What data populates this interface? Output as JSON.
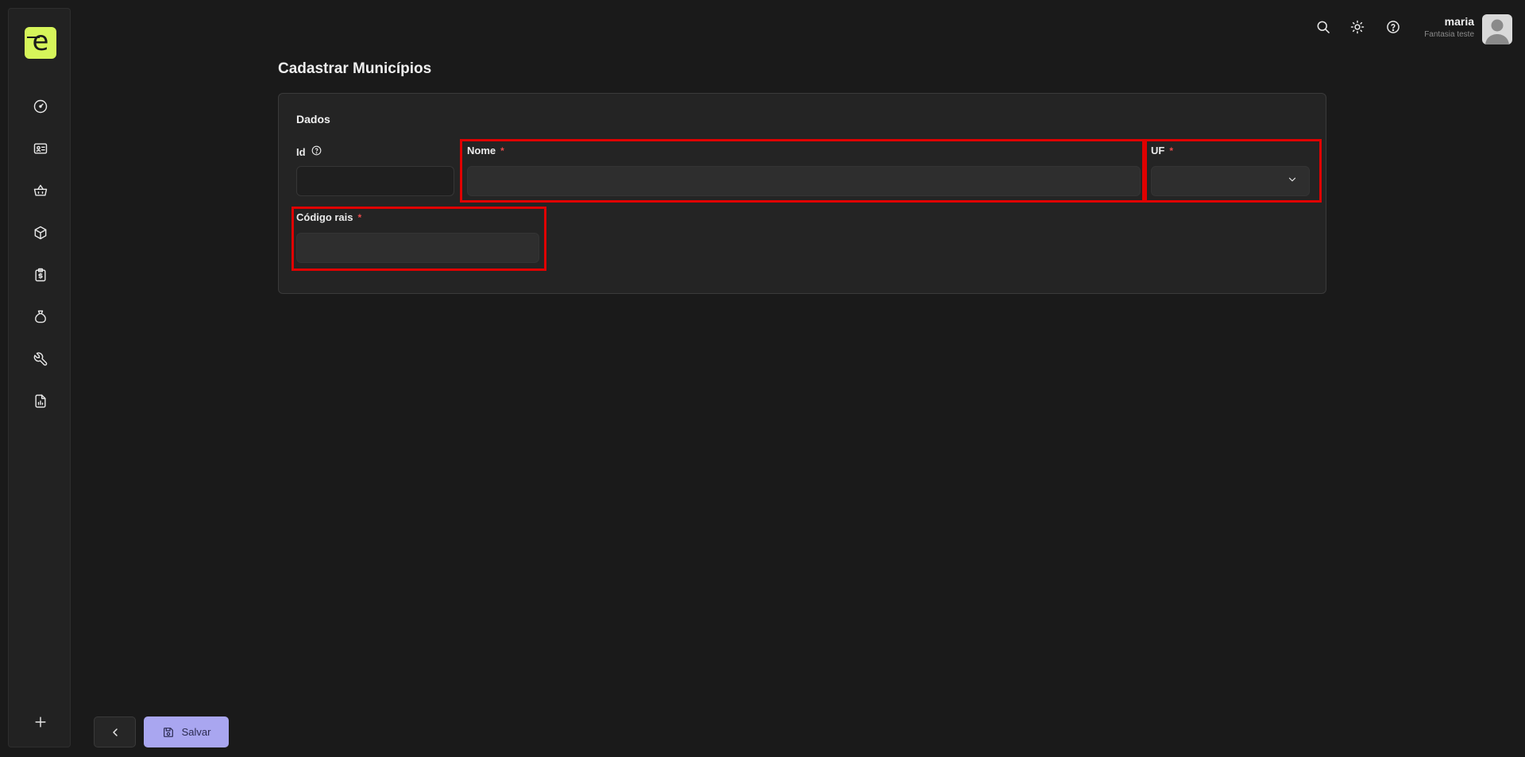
{
  "brand": {
    "logo_letter": "e",
    "accent": "#d6f55a"
  },
  "sidebar": {
    "items": [
      {
        "icon": "gauge-icon"
      },
      {
        "icon": "id-card-icon"
      },
      {
        "icon": "basket-icon"
      },
      {
        "icon": "box-icon"
      },
      {
        "icon": "clipboard-dollar-icon"
      },
      {
        "icon": "money-bag-icon"
      },
      {
        "icon": "wrench-icon"
      },
      {
        "icon": "report-icon"
      }
    ],
    "add_icon": "plus-icon"
  },
  "header": {
    "icons": [
      "search-icon",
      "sun-icon",
      "help-icon"
    ],
    "user": {
      "name": "maria",
      "company": "Fantasia teste"
    }
  },
  "page": {
    "title": "Cadastrar Municípios"
  },
  "form": {
    "section_title": "Dados",
    "fields": {
      "id": {
        "label": "Id",
        "value": ""
      },
      "nome": {
        "label": "Nome",
        "required_mark": "*",
        "value": ""
      },
      "uf": {
        "label": "UF",
        "required_mark": "*",
        "value": ""
      },
      "codigo_rais": {
        "label": "Código rais",
        "required_mark": "*",
        "value": ""
      }
    }
  },
  "actions": {
    "save_label": "Salvar"
  },
  "colors": {
    "background": "#1a1a1a",
    "card": "#242424",
    "save_button": "#a9a6f0",
    "highlight": "#e00000",
    "required": "#e84a4a"
  }
}
